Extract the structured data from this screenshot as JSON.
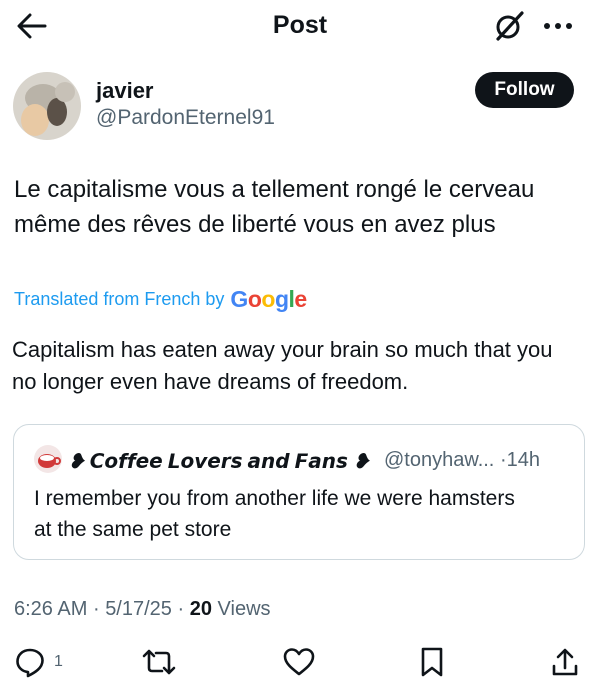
{
  "header": {
    "title": "Post",
    "back_icon": "arrow-left-icon",
    "grok_icon": "grok-icon",
    "more_icon": "more-horizontal-icon"
  },
  "author": {
    "name": "javier",
    "handle": "@PardonEternel91",
    "follow_label": "Follow"
  },
  "post": {
    "text_line1": "Le capitalisme vous a tellement rongé le cerveau",
    "text_line2": "même des rêves de liberté vous en avez plus",
    "translated_label": "Translated from French by",
    "translator": "Google",
    "translation_line1": "Capitalism has eaten away your brain so much that you",
    "translation_line2": "no longer even have dreams of freedom."
  },
  "quote": {
    "author_name": "❥ 𝘾𝙤𝙛𝙛𝙚𝙚 𝙇𝙤𝙫𝙚𝙧𝙨 𝙖𝙣𝙙 𝙁𝙖𝙣𝙨 ❥",
    "author_handle": "@tonyhaw...",
    "separator": "·",
    "time": "14h",
    "text_line1": "I remember you from another life we were hamsters",
    "text_line2": "at the same pet store"
  },
  "meta": {
    "time": "6:26 AM",
    "sep1": "·",
    "date": "5/17/25",
    "sep2": "·",
    "views_count": "20",
    "views_label": "Views"
  },
  "actions": {
    "reply_count": "1",
    "icons": [
      "reply-icon",
      "repost-icon",
      "like-icon",
      "bookmark-icon",
      "share-icon"
    ]
  },
  "colors": {
    "text": "#0f1419",
    "secondary": "#536471",
    "link": "#1d9bf0",
    "follow_bg": "#0f1419",
    "border": "#cfd9de"
  }
}
